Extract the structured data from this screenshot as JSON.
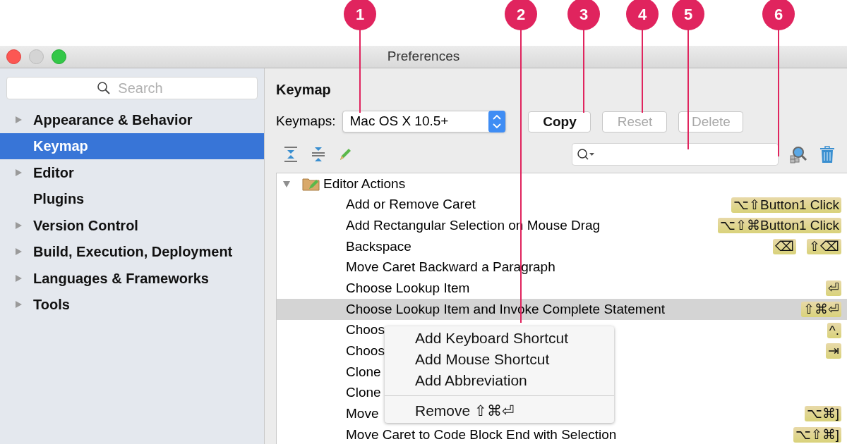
{
  "callouts": [
    {
      "number": "1"
    },
    {
      "number": "2"
    },
    {
      "number": "3"
    },
    {
      "number": "4"
    },
    {
      "number": "5"
    },
    {
      "number": "6"
    }
  ],
  "window": {
    "title": "Preferences"
  },
  "sidebar": {
    "search": {
      "placeholder": "Search"
    },
    "items": [
      {
        "label": "Appearance & Behavior",
        "kind": "group",
        "selected": false
      },
      {
        "label": "Keymap",
        "kind": "page",
        "selected": true
      },
      {
        "label": "Editor",
        "kind": "group",
        "selected": false
      },
      {
        "label": "Plugins",
        "kind": "page",
        "selected": false
      },
      {
        "label": "Version Control",
        "kind": "group",
        "selected": false
      },
      {
        "label": "Build, Execution, Deployment",
        "kind": "group",
        "selected": false
      },
      {
        "label": "Languages & Frameworks",
        "kind": "group",
        "selected": false
      },
      {
        "label": "Tools",
        "kind": "group",
        "selected": false
      }
    ]
  },
  "main": {
    "heading": "Keymap",
    "keymaps_label": "Keymaps:",
    "keymap_value": "Mac OS X 10.5+",
    "buttons": [
      {
        "label": "Copy",
        "disabled": false
      },
      {
        "label": "Reset",
        "disabled": true
      },
      {
        "label": "Delete",
        "disabled": true
      }
    ],
    "tree": {
      "label": "Editor Actions",
      "expanded": true,
      "children": [
        {
          "label": "Add or Remove Caret",
          "selected": false,
          "shortcuts": [
            "⌥⇧Button1 Click"
          ]
        },
        {
          "label": "Add Rectangular Selection on Mouse Drag",
          "selected": false,
          "shortcuts": [
            "⌥⇧⌘Button1 Click"
          ]
        },
        {
          "label": "Backspace",
          "selected": false,
          "shortcuts": [
            "⌫",
            "⇧⌫"
          ]
        },
        {
          "label": "Move Caret Backward a Paragraph",
          "selected": false
        },
        {
          "label": "Choose Lookup Item",
          "selected": false,
          "shortcuts": [
            "⏎"
          ]
        },
        {
          "label": "Choose Lookup Item and Invoke Complete Statement",
          "selected": true,
          "shortcuts": [
            "⇧⌘⏎"
          ]
        },
        {
          "label": "Choos",
          "selected": false,
          "shortcuts": [
            "^."
          ]
        },
        {
          "label": "Choos",
          "selected": false,
          "shortcuts": [
            "⇥"
          ]
        },
        {
          "label": "Clone",
          "selected": false
        },
        {
          "label": "Clone",
          "selected": false
        },
        {
          "label": "Move",
          "selected": false,
          "shortcuts": [
            "⌥⌘]"
          ]
        },
        {
          "label": "Move Caret to Code Block End with Selection",
          "selected": false,
          "shortcuts": [
            "⌥⇧⌘]"
          ]
        }
      ]
    },
    "context_menu": [
      {
        "kind": "item",
        "label": "Add Keyboard Shortcut"
      },
      {
        "kind": "item",
        "label": "Add Mouse Shortcut"
      },
      {
        "kind": "item",
        "label": "Add Abbreviation"
      },
      {
        "kind": "separator"
      },
      {
        "kind": "item",
        "label": "Remove ⇧⌘⏎"
      }
    ]
  }
}
